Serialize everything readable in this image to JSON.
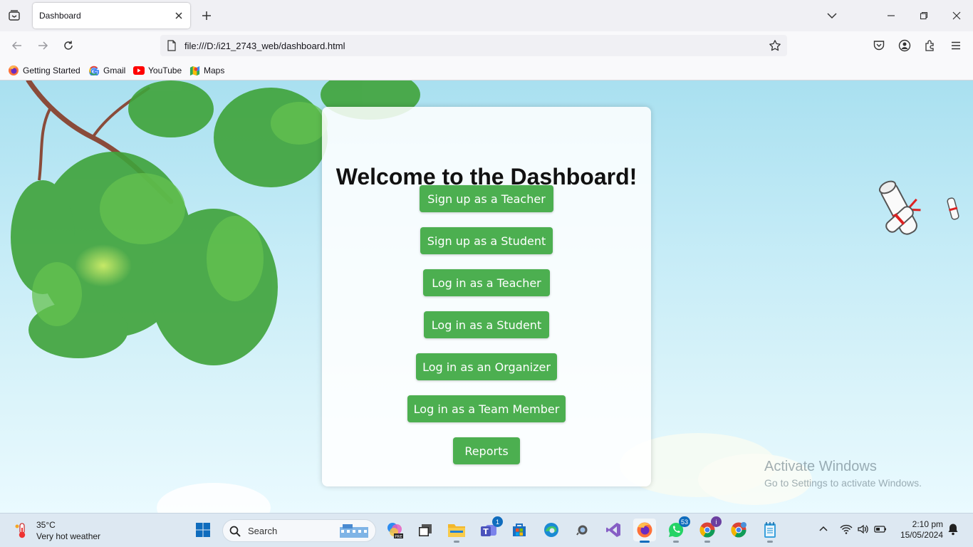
{
  "browser": {
    "tab_title": "Dashboard",
    "url": "file:///D:/i21_2743_web/dashboard.html",
    "bookmarks": [
      {
        "label": "Getting Started",
        "icon": "firefox-icon"
      },
      {
        "label": "Gmail",
        "icon": "google-icon"
      },
      {
        "label": "YouTube",
        "icon": "youtube-icon"
      },
      {
        "label": "Maps",
        "icon": "maps-icon"
      }
    ]
  },
  "page": {
    "heading": "Welcome to the Dashboard!",
    "buttons": [
      "Sign up as a Teacher",
      "Sign up as a Student",
      "Log in as a Teacher",
      "Log in as a Student",
      "Log in as an Organizer",
      "Log in as a Team Member",
      "Reports"
    ],
    "button_color": "#4caf50"
  },
  "watermark": {
    "line1": "Activate Windows",
    "line2": "Go to Settings to activate Windows."
  },
  "taskbar": {
    "weather_temp": "35°C",
    "weather_desc": "Very hot weather",
    "search_label": "Search",
    "badges": {
      "teams": "1",
      "whatsapp": "53",
      "chrome": "i"
    },
    "time": "2:10 pm",
    "date": "15/05/2024"
  }
}
